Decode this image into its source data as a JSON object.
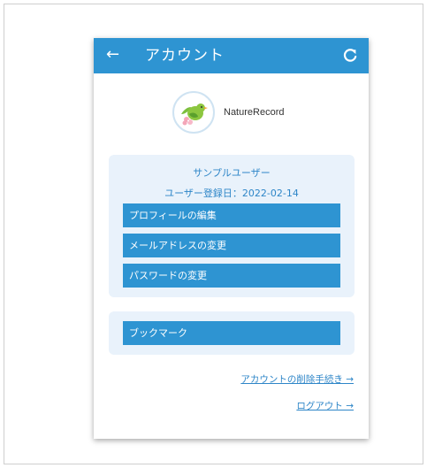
{
  "appbar": {
    "title": "アカウント",
    "back_icon": "←",
    "refresh_icon": "refresh-icon",
    "color": "#2e94d2"
  },
  "brand": {
    "name": "NatureRecord",
    "logo_icon": "bird-logo-icon"
  },
  "profile": {
    "user_name": "サンプルユーザー",
    "registered": "ユーザー登録日：2022-02-14"
  },
  "menu": {
    "edit_profile": "プロフィールの編集",
    "change_email": "メールアドレスの変更",
    "change_password": "パスワードの変更",
    "bookmark": "ブックマーク"
  },
  "links": {
    "delete_account": "アカウントの削除手続き →",
    "logout": "ログアウト →"
  }
}
